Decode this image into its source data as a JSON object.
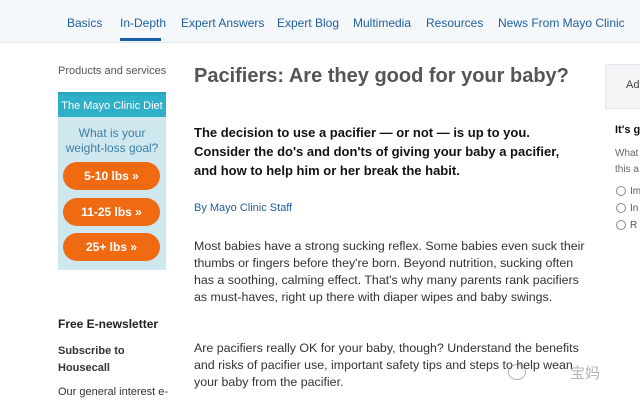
{
  "nav": {
    "items": [
      {
        "label": "Basics"
      },
      {
        "label": "In-Depth"
      },
      {
        "label": "Expert Answers"
      },
      {
        "label": "Expert Blog"
      },
      {
        "label": "Multimedia"
      },
      {
        "label": "Resources"
      },
      {
        "label": "News From Mayo Clinic"
      }
    ],
    "active": "In-Depth"
  },
  "sidebar": {
    "products_label": "Products and services",
    "diet": {
      "title": "The Mayo Clinic Diet",
      "question": "What is your weight-loss goal?",
      "options": [
        "5-10 lbs »",
        "11-25 lbs »",
        "25+ lbs »"
      ]
    },
    "newsletter_heading": "Free E-newsletter",
    "subscribe_label": "Subscribe to Housecall",
    "general_text": "Our general interest e-"
  },
  "article": {
    "title": "Pacifiers: Are they good for your baby?",
    "lead": "The decision to use a pacifier — or not — is up to you. Consider the do's and don'ts of giving your baby a pacifier, and how to help him or her break the habit.",
    "byline": "By Mayo Clinic Staff",
    "paragraphs": [
      "Most babies have a strong sucking reflex. Some babies even suck their thumbs or fingers before they're born. Beyond nutrition, sucking often has a soothing, calming effect. That's why many parents rank pacifiers as must-haves, right up there with diaper wipes and baby swings.",
      "Are pacifiers really OK for your baby, though? Understand the benefits and risks of pacifier use, important safety tips and steps to help wean your baby from the pacifier."
    ]
  },
  "right": {
    "box_text": "Ad",
    "heading": "It's g",
    "question_lines": [
      "What",
      "this a"
    ],
    "radio_labels": [
      "Im",
      "In",
      "R"
    ]
  },
  "watermark": {
    "text": "宝妈"
  },
  "colors": {
    "link": "#1f5fa0",
    "diet_header": "#2eb0c8",
    "diet_bg": "#cfe7ee",
    "pill": "#f06a12"
  }
}
